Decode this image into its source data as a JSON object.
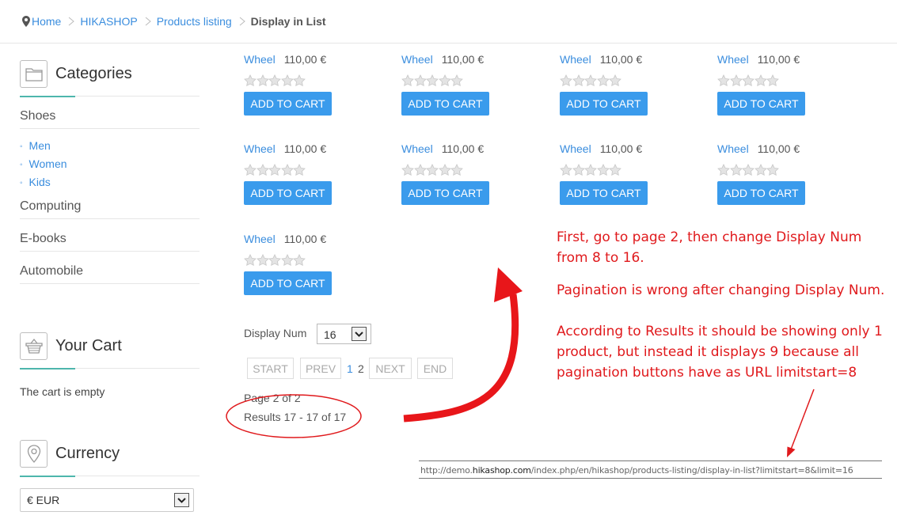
{
  "breadcrumb": {
    "items": [
      "Home",
      "HIKASHOP",
      "Products listing"
    ],
    "current": "Display in List"
  },
  "sidebar": {
    "categories": {
      "title": "Categories",
      "icon": "folder-icon",
      "items": [
        "Shoes",
        "Computing",
        "E-books",
        "Automobile"
      ],
      "subitems": [
        "Men",
        "Women",
        "Kids"
      ]
    },
    "cart": {
      "title": "Your Cart",
      "icon": "basket-icon",
      "empty_text": "The cart is empty"
    },
    "currency": {
      "title": "Currency",
      "icon": "location-pin-icon",
      "selected": "€ EUR"
    }
  },
  "products": [
    {
      "name": "Wheel",
      "price": "110,00 €",
      "button": "ADD TO CART",
      "rating": 0
    },
    {
      "name": "Wheel",
      "price": "110,00 €",
      "button": "ADD TO CART",
      "rating": 0
    },
    {
      "name": "Wheel",
      "price": "110,00 €",
      "button": "ADD TO CART",
      "rating": 0
    },
    {
      "name": "Wheel",
      "price": "110,00 €",
      "button": "ADD TO CART",
      "rating": 0
    },
    {
      "name": "Wheel",
      "price": "110,00 €",
      "button": "ADD TO CART",
      "rating": 0
    },
    {
      "name": "Wheel",
      "price": "110,00 €",
      "button": "ADD TO CART",
      "rating": 0
    },
    {
      "name": "Wheel",
      "price": "110,00 €",
      "button": "ADD TO CART",
      "rating": 0
    },
    {
      "name": "Wheel",
      "price": "110,00 €",
      "button": "ADD TO CART",
      "rating": 0
    },
    {
      "name": "Wheel",
      "price": "110,00 €",
      "button": "ADD TO CART",
      "rating": 0
    }
  ],
  "display_num": {
    "label": "Display Num",
    "selected": "16"
  },
  "pagination": {
    "start": "START",
    "prev": "PREV",
    "page1": "1",
    "page2": "2",
    "next": "NEXT",
    "end": "END",
    "page_of": "Page 2 of 2",
    "results": "Results 17 - 17 of 17"
  },
  "annotations": {
    "note1_line1": "First, go to page 2, then change Display Num",
    "note1_line2": "from 8 to 16.",
    "note2": "Pagination is wrong after changing Display Num.",
    "note3_line1": "According to Results it should be showing only 1",
    "note3_line2": "product, but instead it displays 9 because all",
    "note3_line3": "pagination buttons have as URL limitstart=8",
    "url_prefix": "http://demo.",
    "url_host": "hikashop.com",
    "url_path": "/index.php/en/hikashop/products-listing/display-in-list?limitstart=8&limit=16"
  },
  "colors": {
    "link": "#3a8dde",
    "button": "#3a9bec",
    "accent": "#4db6ac",
    "annotation": "#e0191c"
  }
}
